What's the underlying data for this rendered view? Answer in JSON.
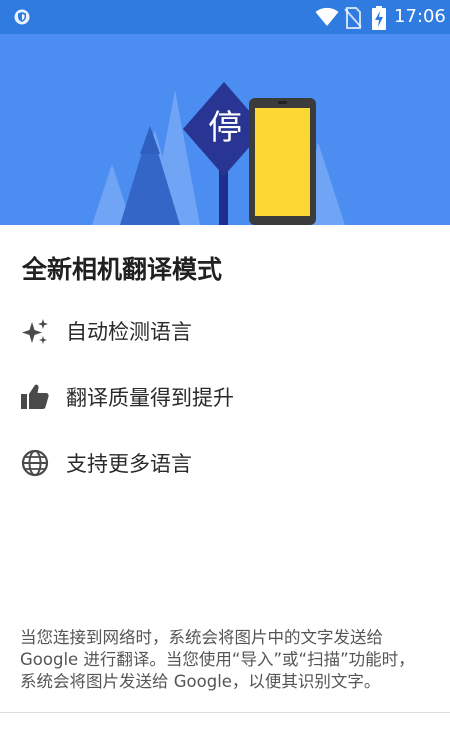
{
  "status_bar": {
    "time": "17:06",
    "icons": [
      "shield-icon",
      "wifi-icon",
      "no-sim-icon",
      "battery-charging-icon"
    ],
    "bg_color": "#2f7be0"
  },
  "hero": {
    "sign_text": "停",
    "bg_color": "#4b8df0",
    "phone_screen_color": "#fdd835"
  },
  "title": "全新相机翻译模式",
  "features": [
    {
      "icon": "sparkle-icon",
      "label": "自动检测语言"
    },
    {
      "icon": "thumbs-up-icon",
      "label": "翻译质量得到提升"
    },
    {
      "icon": "globe-icon",
      "label": "支持更多语言"
    }
  ],
  "footer": {
    "lines": [
      "当您连接到网络时，系统会将图片中的文字发送给",
      "Google 进行翻译。当您使用“导入”或“扫描”功能时，",
      "系统会将图片发送给 Google，以便其识别文字。"
    ]
  }
}
